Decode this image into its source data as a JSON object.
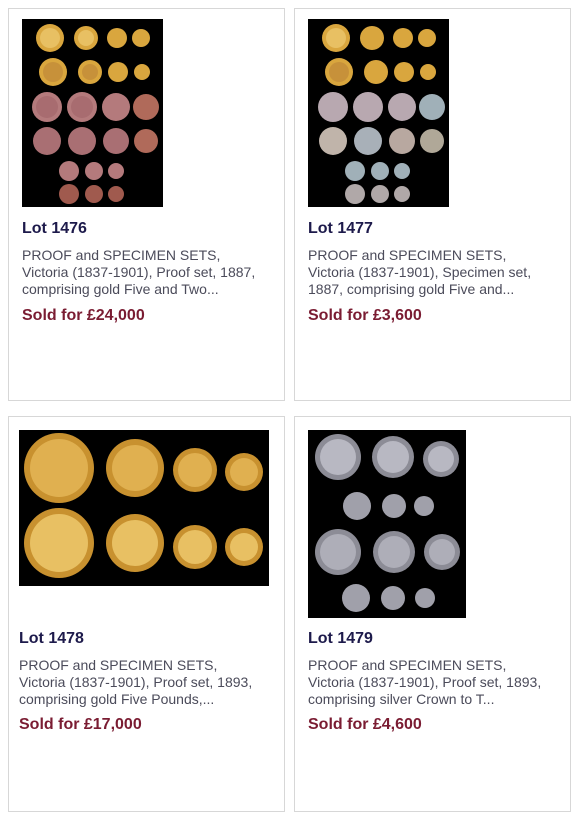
{
  "lots": [
    {
      "lot": "Lot 1476",
      "desc_lines": [
        "PROOF and SPECIMEN SETS,",
        "Victoria (1837-1901), Proof set, 1887,",
        "comprising gold Five and Two..."
      ],
      "sold": "Sold for £24,000",
      "image_icon": "coin-set-photo-icon"
    },
    {
      "lot": "Lot 1477",
      "desc_lines": [
        "PROOF and SPECIMEN SETS,",
        "Victoria (1837-1901), Specimen set,",
        "1887, comprising gold Five and..."
      ],
      "sold": "Sold for £3,600",
      "image_icon": "coin-set-photo-icon"
    },
    {
      "lot": "Lot 1478",
      "desc_lines": [
        "PROOF and SPECIMEN SETS,",
        "Victoria (1837-1901), Proof set, 1893,",
        "comprising gold Five Pounds,..."
      ],
      "sold": "Sold for £17,000",
      "image_icon": "gold-coin-set-photo-icon"
    },
    {
      "lot": "Lot 1479",
      "desc_lines": [
        "PROOF and SPECIMEN SETS,",
        "Victoria (1837-1901), Proof set, 1893,",
        "comprising silver Crown to T..."
      ],
      "sold": "Sold for £4,600",
      "image_icon": "silver-coin-set-photo-icon"
    }
  ],
  "colors": {
    "lot_title": "#1d1a4b",
    "sold": "#7a1c32",
    "desc": "#4b4b5a",
    "gold": "#d9a63e",
    "copper": "#b06a5a",
    "silver": "#b8b8c2"
  }
}
